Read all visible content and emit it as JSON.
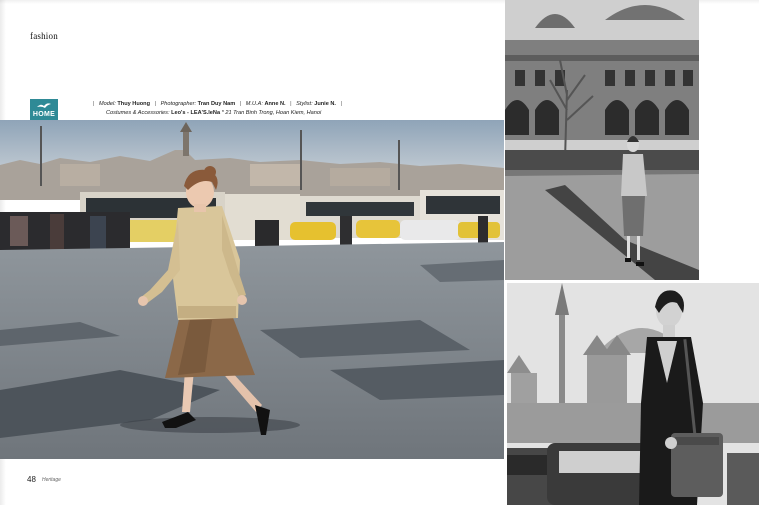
{
  "section": "fashion",
  "badge": {
    "label": "HOME",
    "color": "#2f8a96",
    "icon": "bird-logo-icon"
  },
  "credits": {
    "line1": [
      {
        "label": "Model:",
        "value": "Thuy Huong"
      },
      {
        "label": "Photographer:",
        "value": "Tran Duy Nam"
      },
      {
        "label": "M.U.A:",
        "value": "Anne N."
      },
      {
        "label": "Stylist:",
        "value": "Junie N."
      }
    ],
    "line2_label": "Costumes & Accessories:",
    "line2_value": "Leo's - LEA'S.leNa",
    "line2_address": "* 21 Tran Binh Trong, Hoan Kiem, Hanoi"
  },
  "footer": {
    "page_number": "48",
    "magazine": "Heritage"
  }
}
